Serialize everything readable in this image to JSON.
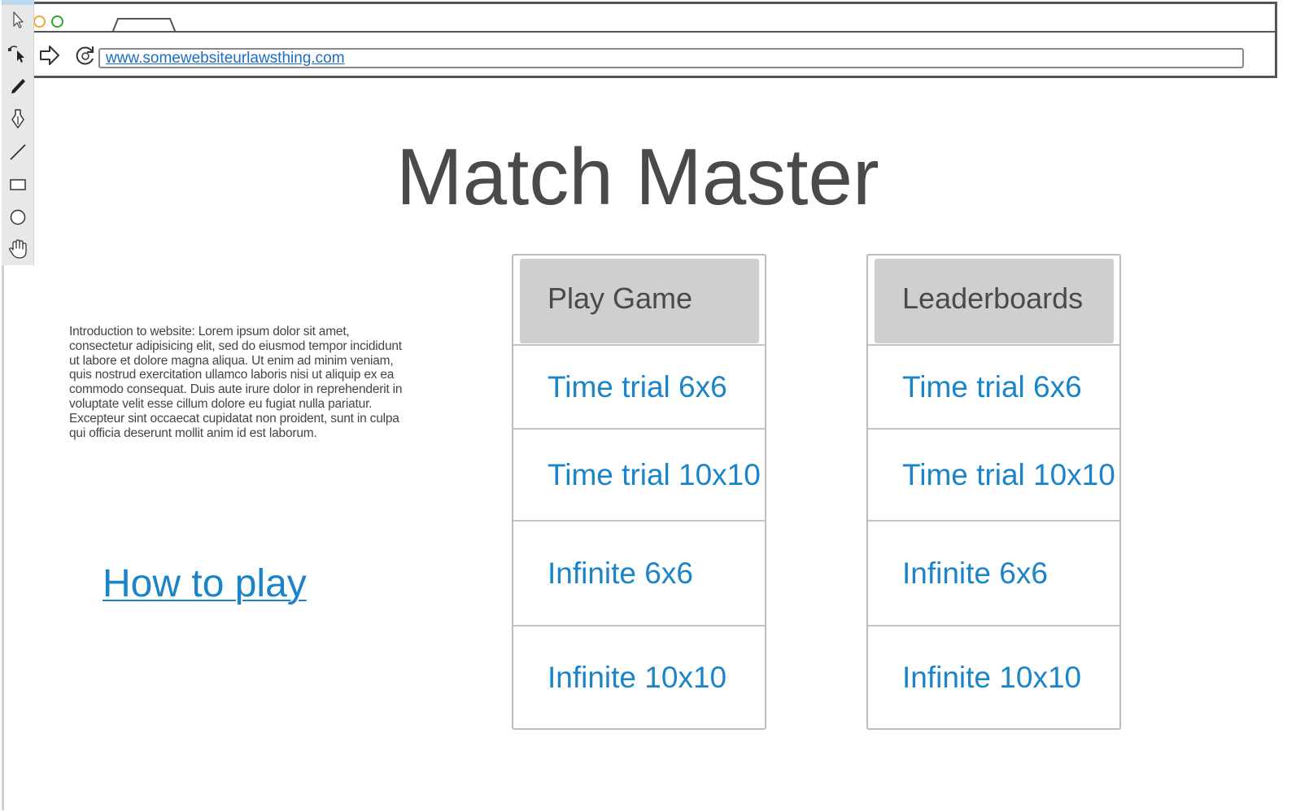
{
  "browser": {
    "url": "www.somewebsiteurlawsthing.com"
  },
  "toolbar": {
    "tools": [
      "pointer-icon",
      "node-select-icon",
      "pencil-icon",
      "pen-icon",
      "line-icon",
      "rectangle-icon",
      "ellipse-icon",
      "hand-icon"
    ]
  },
  "page": {
    "title": "Match Master",
    "intro": "Introduction to website: Lorem ipsum dolor sit amet, consectetur adipisicing elit, sed do eiusmod tempor incididunt ut labore et dolore magna aliqua. Ut enim ad minim veniam, quis nostrud exercitation ullamco laboris nisi ut aliquip ex ea commodo consequat. Duis aute irure dolor in reprehenderit in voluptate velit esse cillum dolore eu fugiat nulla pariatur. Excepteur sint occaecat cupidatat non proident, sunt in culpa qui officia deserunt mollit anim id est laborum.",
    "how_to_play": "How to play"
  },
  "play_menu": {
    "header": "Play Game",
    "items": [
      "Time trial 6x6",
      "Time trial 10x10",
      "Infinite 6x6",
      "Infinite 10x10"
    ]
  },
  "leaderboard_menu": {
    "header": "Leaderboards",
    "items": [
      "Time trial 6x6",
      "Time trial 10x10",
      "Infinite 6x6",
      "Infinite 10x10"
    ]
  },
  "colors": {
    "link": "#1a84c8",
    "header_bg": "#cfcfcf",
    "title": "#4a4a4a",
    "close_dot": "#f2a33a",
    "maximize_dot": "#2aa52a"
  }
}
